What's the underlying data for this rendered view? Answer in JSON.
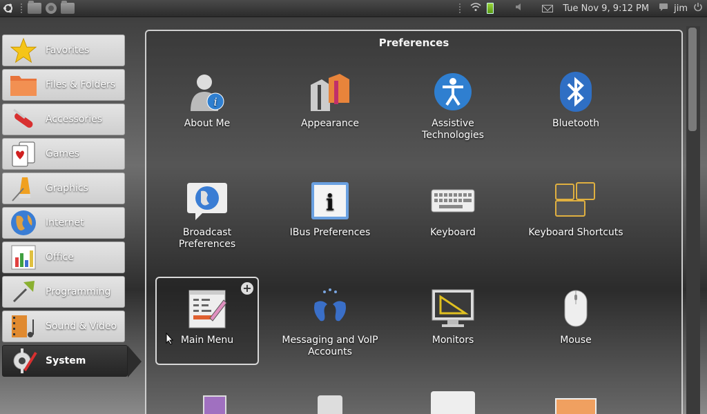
{
  "panel": {
    "clock": "Tue Nov  9,  9:12 PM",
    "user": "jim"
  },
  "sidebar": {
    "items": [
      {
        "label": "Favorites"
      },
      {
        "label": "Files & Folders"
      },
      {
        "label": "Accessories"
      },
      {
        "label": "Games"
      },
      {
        "label": "Graphics"
      },
      {
        "label": "Internet"
      },
      {
        "label": "Office"
      },
      {
        "label": "Programming"
      },
      {
        "label": "Sound & Video"
      },
      {
        "label": "System",
        "selected": true
      }
    ]
  },
  "main": {
    "title": "Preferences",
    "items": [
      {
        "label": "About Me",
        "icon": "user-info-icon"
      },
      {
        "label": "Appearance",
        "icon": "appearance-icon"
      },
      {
        "label": "Assistive Technologies",
        "icon": "accessibility-icon"
      },
      {
        "label": "Bluetooth",
        "icon": "bluetooth-icon"
      },
      {
        "label": "Broadcast Preferences",
        "icon": "broadcast-icon"
      },
      {
        "label": "IBus Preferences",
        "icon": "ibus-icon"
      },
      {
        "label": "Keyboard",
        "icon": "keyboard-icon"
      },
      {
        "label": "Keyboard Shortcuts",
        "icon": "keyboard-shortcuts-icon"
      },
      {
        "label": "Main Menu",
        "icon": "main-menu-icon",
        "focused": true
      },
      {
        "label": "Messaging and VoIP Accounts",
        "icon": "messaging-icon"
      },
      {
        "label": "Monitors",
        "icon": "monitor-icon"
      },
      {
        "label": "Mouse",
        "icon": "mouse-icon"
      }
    ]
  },
  "colors": {
    "selected_category_bg": "#2c2c2c",
    "category_bg": "#d8d8d8",
    "accent_blue": "#2f7fd0"
  }
}
